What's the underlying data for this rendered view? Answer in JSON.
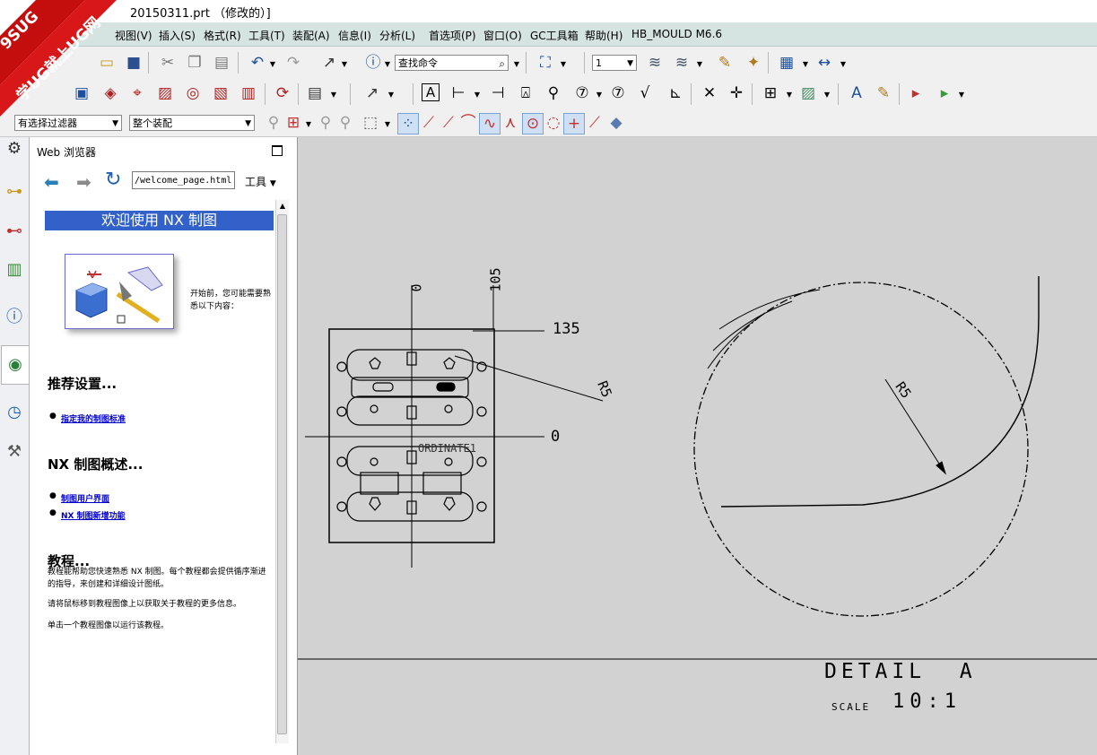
{
  "window": {
    "title": "20150311.prt （修改的）]"
  },
  "watermark": {
    "line1": "9SUG",
    "line2": "学UG就上UG网"
  },
  "menu": [
    "视图(V)",
    "插入(S)",
    "格式(R)",
    "工具(T)",
    "装配(A)",
    "信息(I)",
    "分析(L)",
    "首选项(P)",
    "窗口(O)",
    "GC工具箱",
    "帮助(H)",
    "HB_MOULD M6.6"
  ],
  "toolbar": {
    "find_command_placeholder": "查找命令",
    "layer_value": "1",
    "selection_filter": "有选择过滤器",
    "assembly_scope": "整个装配"
  },
  "panel": {
    "title": "Web 浏览器",
    "url": "/welcome_page.html",
    "tools_label": "工具"
  },
  "page": {
    "banner": "欢迎使用 NX 制图",
    "intro": "开始前，您可能需要熟悉以下内容：",
    "section1": "推荐设置...",
    "link1": "指定我的制图标准",
    "section2": "NX 制图概述...",
    "link2": "制图用户界面",
    "link3": "NX 制图新增功能",
    "section3": "教程...",
    "para1": "教程能帮助您快速熟悉 NX 制图。每个教程都会提供循序渐进的指导，来创建和详细设计图纸。",
    "para2": "请将鼠标移到教程图像上以获取关于教程的更多信息。",
    "para3": "单击一个教程图像以运行该教程。"
  },
  "drawing": {
    "dim_0_top": "0",
    "dim_105": "105",
    "dim_135": "135",
    "dim_r5_left": "R5",
    "dim_0_right": "0",
    "ordinate_label": "ORDINATE1",
    "dim_r5_detail": "R5",
    "detail_title": "DETAIL  A",
    "scale_label": "SCALE",
    "scale_value": "10:1"
  },
  "icons": {
    "resource": [
      "gear-icon",
      "assembly-navigator-icon",
      "part-navigator-icon",
      "reuse-library-icon",
      "roles-icon",
      "web-browser-icon",
      "history-icon",
      "system-materials-icon"
    ]
  }
}
